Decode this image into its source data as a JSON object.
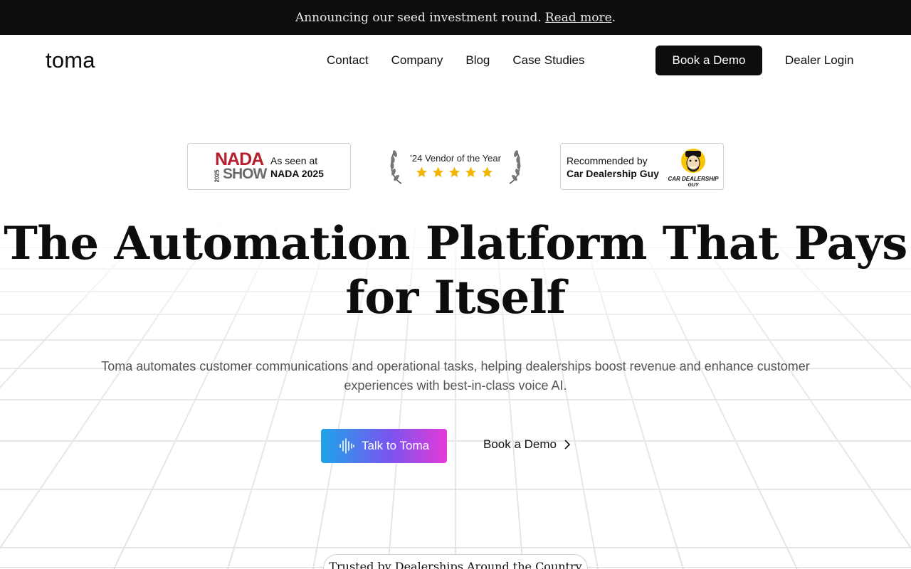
{
  "announcement": {
    "text": "Announcing our seed investment round.",
    "link_label": "Read more",
    "suffix": "."
  },
  "nav": {
    "logo": "toma",
    "links": [
      "Contact",
      "Company",
      "Blog",
      "Case Studies"
    ],
    "book_demo": "Book a Demo",
    "dealer_login": "Dealer Login"
  },
  "badges": {
    "nada": {
      "logo_word": "NADA",
      "logo_show": "SHOW",
      "logo_year": "2025",
      "line1": "As seen at",
      "line2": "NADA 2025"
    },
    "vendor": {
      "title": "’24 Vendor of the Year",
      "stars": 5
    },
    "cdg": {
      "line1": "Recommended by",
      "line2": "Car Dealership Guy",
      "logo_text1": "CAR DEALERSHIP",
      "logo_text2": "GUY"
    }
  },
  "hero": {
    "title_line1": "The Automation Platform That Pays",
    "title_line2": "for Itself",
    "subtitle_line1": "Toma automates customer communications and operational tasks, helping dealerships boost revenue and enhance customer",
    "subtitle_line2": "experiences with best-in-class voice AI.",
    "talk_button": "Talk to Toma",
    "demo_button": "Book a Demo"
  },
  "trusted": {
    "label": "Trusted by Dealerships Around the Country"
  },
  "colors": {
    "announcement_bg": "#0d0d0d",
    "primary_button": "#0d0d0d",
    "gradient_start": "#1ea4e8",
    "gradient_mid": "#7b54f0",
    "gradient_end": "#e33ad6",
    "nada_red": "#b5202e",
    "star": "#f2b705"
  }
}
